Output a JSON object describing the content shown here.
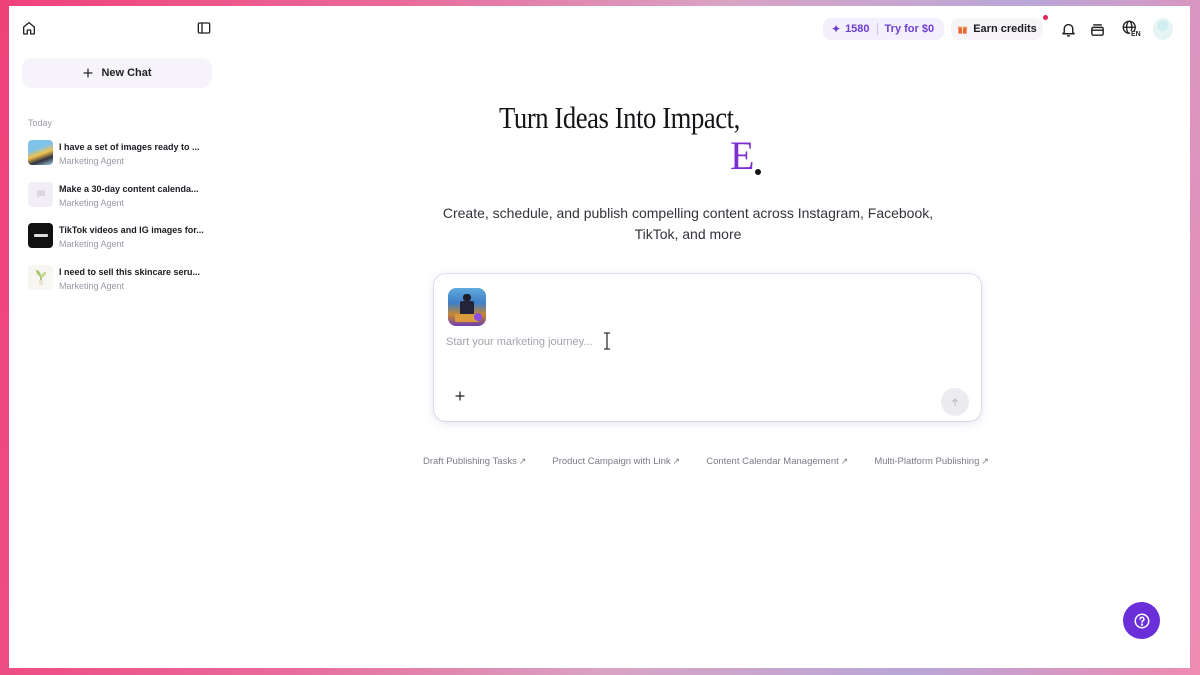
{
  "sidebar": {
    "new_chat_label": "New Chat",
    "section_today": "Today",
    "chats": [
      {
        "title": "I have a set of images ready to ...",
        "subtitle": "Marketing Agent"
      },
      {
        "title": "Make a 30-day content calenda...",
        "subtitle": "Marketing Agent"
      },
      {
        "title": "TikTok videos and IG images for...",
        "subtitle": "Marketing Agent"
      },
      {
        "title": "I need to sell this skincare seru...",
        "subtitle": "Marketing Agent"
      }
    ]
  },
  "header": {
    "credits_value": "1580",
    "try_label": "Try for $0",
    "earn_label": "Earn credits",
    "language_code": "EN",
    "accent_color": "#6c3fd1",
    "notification_dot_color": "#e0235a"
  },
  "hero": {
    "title": "Turn Ideas Into Impact,",
    "letter": "E",
    "subtitle": "Create, schedule, and publish compelling content across Instagram, Facebook, TikTok, and more",
    "letter_color": "#7d2fd0"
  },
  "composer": {
    "placeholder": "Start your marketing journey...",
    "value": ""
  },
  "suggestions": [
    {
      "label": "Draft Publishing Tasks",
      "arrow": "↗"
    },
    {
      "label": "Product Campaign with Link",
      "arrow": "↗"
    },
    {
      "label": "Content Calendar Management",
      "arrow": "↗"
    },
    {
      "label": "Multi-Platform Publishing",
      "arrow": "↗"
    }
  ],
  "icons": {
    "home": "home-icon",
    "sidebar_toggle": "sidebar-toggle-icon",
    "plus": "plus-icon",
    "sparkle": "sparkle-icon",
    "gift": "gift-icon",
    "bell": "bell-icon",
    "layers": "stack-icon",
    "globe": "globe-icon",
    "send": "arrow-up-icon",
    "help": "help-icon"
  },
  "help_button_color": "#6a2fd8"
}
